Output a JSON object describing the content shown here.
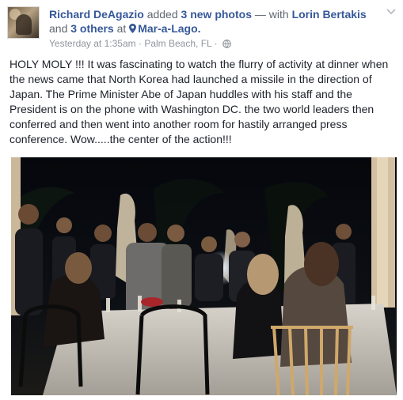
{
  "post": {
    "author": "Richard DeAgazio",
    "action": "added",
    "photos": "3 new photos",
    "with_text": "— with",
    "tagged_person": "Lorin Bertakis",
    "and": "and",
    "others": "3 others",
    "at": "at",
    "location": "Mar-a-Lago.",
    "timestamp": "Yesterday at 1:35am",
    "place": "Palm Beach, FL",
    "separator": "·",
    "text": "HOLY MOLY !!! It was fascinating to watch the flurry of activity at dinner when the news came that North Korea had launched a missile in the direction of Japan. The Prime Minister Abe of Japan huddles with his staff and the President is on the phone with Washington DC. the two world leaders then conferred and then went into another room for hastily arranged press conference. Wow.....the center of the action!!!"
  },
  "icons": {
    "location": "map-pin-icon",
    "privacy": "globe-icon",
    "options": "chevron-down-icon"
  },
  "colors": {
    "link": "#365899",
    "text": "#1d2129",
    "meta": "#90949c"
  }
}
